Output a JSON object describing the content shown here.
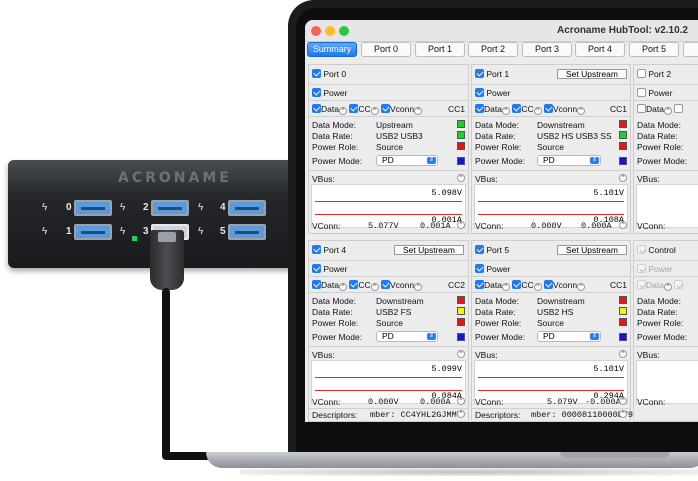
{
  "hub": {
    "brand": "ACRONAME",
    "port_numbers": [
      "0",
      "1",
      "2",
      "3",
      "4",
      "5"
    ]
  },
  "window": {
    "title": "Acroname HubTool: v2.10.2"
  },
  "tabs": [
    "Summary",
    "Port 0",
    "Port 1",
    "Port 2",
    "Port 3",
    "Port 4",
    "Port 5",
    "C"
  ],
  "active_tab": "Summary",
  "labels": {
    "power": "Power",
    "data": "Data",
    "cc": "CC",
    "vconn": "Vconn",
    "data_mode": "Data Mode:",
    "data_rate": "Data Rate:",
    "power_role": "Power Role:",
    "power_mode": "Power Mode:",
    "vbus": "VBus:",
    "vconn_readout": "VConn:",
    "descriptors": "Descriptors:",
    "set_upstream": "Set Upstream",
    "control": "Control"
  },
  "ports": [
    {
      "name": "Port 0",
      "cc_label": "CC1",
      "data_mode": "Upstream",
      "data_rate": "USB2 USB3",
      "power_role": "Source",
      "power_mode": "PD",
      "vbus_voltage": "5.098V",
      "vbus_current": "0.001A",
      "vconn_voltage": "5.077V",
      "vconn_current": "0.001A",
      "status_colors": [
        "#1ed027",
        "#1ed027",
        "#e3161c",
        "#1414e0"
      ]
    },
    {
      "name": "Port 1",
      "cc_label": "CC1",
      "data_mode": "Downstream",
      "data_rate": "USB2 HS USB3 SS",
      "power_role": "Source",
      "power_mode": "PD",
      "vbus_voltage": "5.101V",
      "vbus_current": "0.108A",
      "vconn_voltage": "0.000V",
      "vconn_current": "0.000A",
      "status_colors": [
        "#e3161c",
        "#1ed027",
        "#e3161c",
        "#1414e0"
      ]
    },
    {
      "name": "Port 4",
      "cc_label": "CC2",
      "data_mode": "Downstream",
      "data_rate": "USB2 FS",
      "power_role": "Source",
      "power_mode": "PD",
      "vbus_voltage": "5.099V",
      "vbus_current": "0.084A",
      "vconn_voltage": "0.000V",
      "vconn_current": "0.000A",
      "descriptor": "mber: CC4YHL2GJMMT",
      "status_colors": [
        "#e3161c",
        "#f4f40c",
        "#e3161c",
        "#1414e0"
      ]
    },
    {
      "name": "Port 5",
      "cc_label": "CC1",
      "data_mode": "Downstream",
      "data_rate": "USB2 HS",
      "power_role": "Source",
      "power_mode": "PD",
      "vbus_voltage": "5.101V",
      "vbus_current": "0.294A",
      "vconn_voltage": "5.079V",
      "vconn_current": "-0.000A",
      "descriptor": "mber: 00008110000E79",
      "status_colors": [
        "#e3161c",
        "#f4f40c",
        "#e3161c",
        "#1414e0"
      ]
    }
  ],
  "partial_port": {
    "name": "Port 2"
  }
}
